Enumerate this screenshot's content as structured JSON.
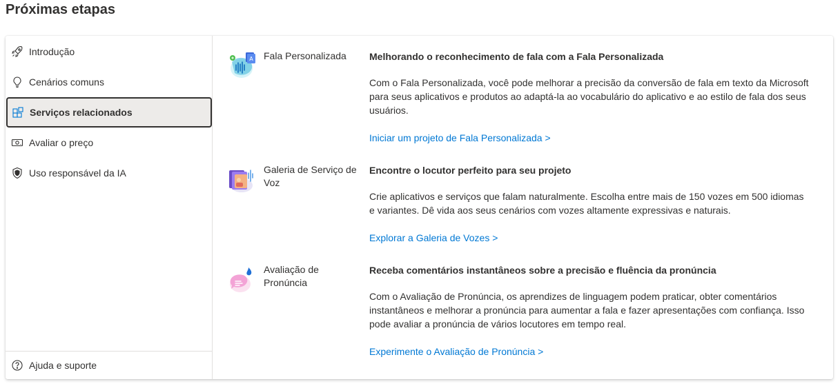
{
  "page": {
    "title": "Próximas etapas"
  },
  "sidebar": {
    "items": [
      {
        "label": "Introdução",
        "icon": "rocket-icon"
      },
      {
        "label": "Cenários comuns",
        "icon": "lightbulb-icon"
      },
      {
        "label": "Serviços relacionados",
        "icon": "grid-icon",
        "active": true
      },
      {
        "label": "Avaliar o preço",
        "icon": "money-icon"
      },
      {
        "label": "Uso responsável da IA",
        "icon": "shield-icon"
      }
    ],
    "footer": {
      "label": "Ajuda e suporte",
      "icon": "help-icon"
    }
  },
  "services": [
    {
      "name": "Fala Personalizada",
      "icon": "custom-speech-icon",
      "heading": "Melhorando o reconhecimento de fala com a Fala Personalizada",
      "description": "Com o Fala Personalizada, você pode melhorar a precisão da conversão de fala em texto da Microsoft para seus aplicativos e produtos ao adaptá-la ao vocabulário do aplicativo e ao estilo de fala dos seus usuários.",
      "link": "Iniciar um projeto de Fala Personalizada >"
    },
    {
      "name": "Galeria de Serviço de Voz",
      "icon": "voice-gallery-icon",
      "heading": "Encontre o locutor perfeito para seu projeto",
      "description": "Crie aplicativos e serviços que falam naturalmente. Escolha entre mais de 150 vozes em 500 idiomas e variantes. Dê vida aos seus cenários com vozes altamente expressivas e naturais.",
      "link": "Explorar a Galeria de Vozes >"
    },
    {
      "name": "Avaliação de Pronúncia",
      "icon": "pronunciation-icon",
      "heading": "Receba comentários instantâneos sobre a precisão e fluência da pronúncia",
      "description": "Com o Avaliação de Pronúncia, os aprendizes de linguagem podem praticar, obter comentários instantâneos e melhorar a pronúncia para aumentar a fala e fazer apresentações com confiança. Isso pode avaliar a pronúncia de vários locutores em tempo real.",
      "link": "Experimente o Avaliação de Pronúncia >"
    }
  ],
  "colors": {
    "link": "#0078d4",
    "text": "#323130",
    "active_bg": "#edebe9"
  }
}
